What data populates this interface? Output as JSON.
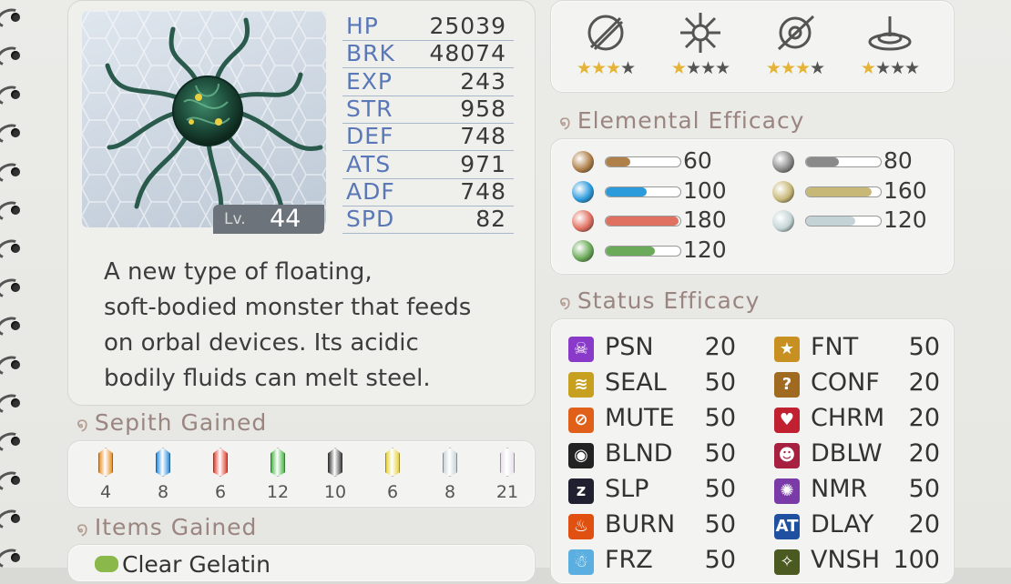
{
  "monster": {
    "level_label": "Lv.",
    "level": "44",
    "description": "A new type of floating,\nsoft-bodied monster that feeds\non orbal devices. Its acidic\nbodily fluids can melt steel."
  },
  "stats": [
    {
      "label": "HP",
      "value": "25039"
    },
    {
      "label": "BRK",
      "value": "48074"
    },
    {
      "label": "EXP",
      "value": "243"
    },
    {
      "label": "STR",
      "value": "958"
    },
    {
      "label": "DEF",
      "value": "748"
    },
    {
      "label": "ATS",
      "value": "971"
    },
    {
      "label": "ADF",
      "value": "748"
    },
    {
      "label": "SPD",
      "value": "82"
    }
  ],
  "sections": {
    "sepith": "Sepith Gained",
    "items": "Items Gained",
    "elemental": "Elemental Efficacy",
    "status": "Status Efficacy"
  },
  "sepith": [
    {
      "color": "#e8922a",
      "count": "4"
    },
    {
      "color": "#2c8fe0",
      "count": "8"
    },
    {
      "color": "#e04a3a",
      "count": "6"
    },
    {
      "color": "#4cb848",
      "count": "12"
    },
    {
      "color": "#444444",
      "count": "10"
    },
    {
      "color": "#e8d23a",
      "count": "6"
    },
    {
      "color": "#c9d4d8",
      "count": "8"
    },
    {
      "color": "#e8e0ea",
      "count": "21"
    }
  ],
  "items": [
    {
      "label": "Clear Gelatin"
    }
  ],
  "damage_ranks": [
    {
      "icon": "slash-icon",
      "stars": 3
    },
    {
      "icon": "burst-icon",
      "stars": 1
    },
    {
      "icon": "pierce-icon",
      "stars": 3
    },
    {
      "icon": "wave-icon",
      "stars": 1
    }
  ],
  "elements": [
    {
      "name": "earth",
      "color": "#b0804a",
      "value": "60",
      "level": 0.33
    },
    {
      "name": "water",
      "color": "#2c9bdc",
      "value": "100",
      "level": 0.55
    },
    {
      "name": "fire",
      "color": "#e07060",
      "value": "180",
      "level": 0.98
    },
    {
      "name": "wind",
      "color": "#6aaa58",
      "value": "120",
      "level": 0.66
    },
    {
      "name": "time",
      "color": "#8a8a8a",
      "value": "80",
      "level": 0.44
    },
    {
      "name": "space",
      "color": "#c8b878",
      "value": "160",
      "level": 0.88
    },
    {
      "name": "mirage",
      "color": "#c4d4d6",
      "value": "120",
      "level": 0.66
    }
  ],
  "status_effects": [
    {
      "name": "PSN",
      "value": "20",
      "color": "#8a3ac8",
      "glyph": "☠"
    },
    {
      "name": "SEAL",
      "value": "50",
      "color": "#c8a020",
      "glyph": "≋"
    },
    {
      "name": "MUTE",
      "value": "50",
      "color": "#e0601a",
      "glyph": "⊘"
    },
    {
      "name": "BLND",
      "value": "50",
      "color": "#222222",
      "glyph": "◉"
    },
    {
      "name": "SLP",
      "value": "50",
      "color": "#202030",
      "glyph": "z"
    },
    {
      "name": "BURN",
      "value": "50",
      "color": "#e05010",
      "glyph": "♨"
    },
    {
      "name": "FRZ",
      "value": "50",
      "color": "#5aaee0",
      "glyph": "☃"
    },
    {
      "name": "FNT",
      "value": "50",
      "color": "#c89020",
      "glyph": "★"
    },
    {
      "name": "CONF",
      "value": "20",
      "color": "#a06a20",
      "glyph": "?"
    },
    {
      "name": "CHRM",
      "value": "20",
      "color": "#c02030",
      "glyph": "♥"
    },
    {
      "name": "DBLW",
      "value": "20",
      "color": "#a82040",
      "glyph": "☻"
    },
    {
      "name": "NMR",
      "value": "50",
      "color": "#7a3aa8",
      "glyph": "✺"
    },
    {
      "name": "DLAY",
      "value": "20",
      "color": "#2050a0",
      "glyph": "AT"
    },
    {
      "name": "VNSH",
      "value": "100",
      "color": "#4a5a20",
      "glyph": "✧"
    }
  ]
}
